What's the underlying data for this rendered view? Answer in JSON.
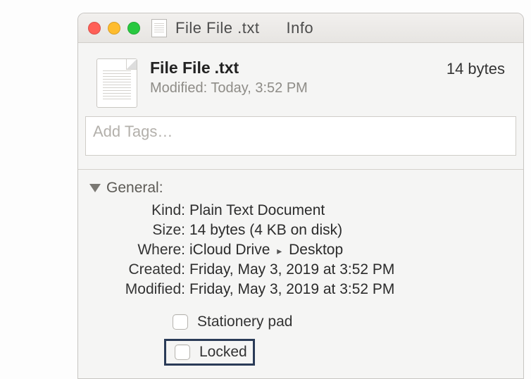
{
  "window": {
    "filename_title": "File File .txt",
    "title_suffix": "Info"
  },
  "summary": {
    "filename_bold": "File File",
    "filename_ext": ".txt",
    "size": "14 bytes",
    "modified_label": "Modified:",
    "modified_value": "Today, 3:52 PM"
  },
  "tags": {
    "placeholder": "Add Tags…"
  },
  "section": {
    "general_label": "General:"
  },
  "kv": {
    "kind_label": "Kind:",
    "kind_value": "Plain Text Document",
    "size_label": "Size:",
    "size_value": "14 bytes (4 KB on disk)",
    "where_label": "Where:",
    "where_value_1": "iCloud Drive",
    "where_value_2": "Desktop",
    "created_label": "Created:",
    "created_value": "Friday, May 3, 2019 at 3:52 PM",
    "modified_label": "Modified:",
    "modified_value": "Friday, May 3, 2019 at 3:52 PM"
  },
  "checks": {
    "stationery_label": "Stationery pad",
    "locked_label": "Locked"
  }
}
